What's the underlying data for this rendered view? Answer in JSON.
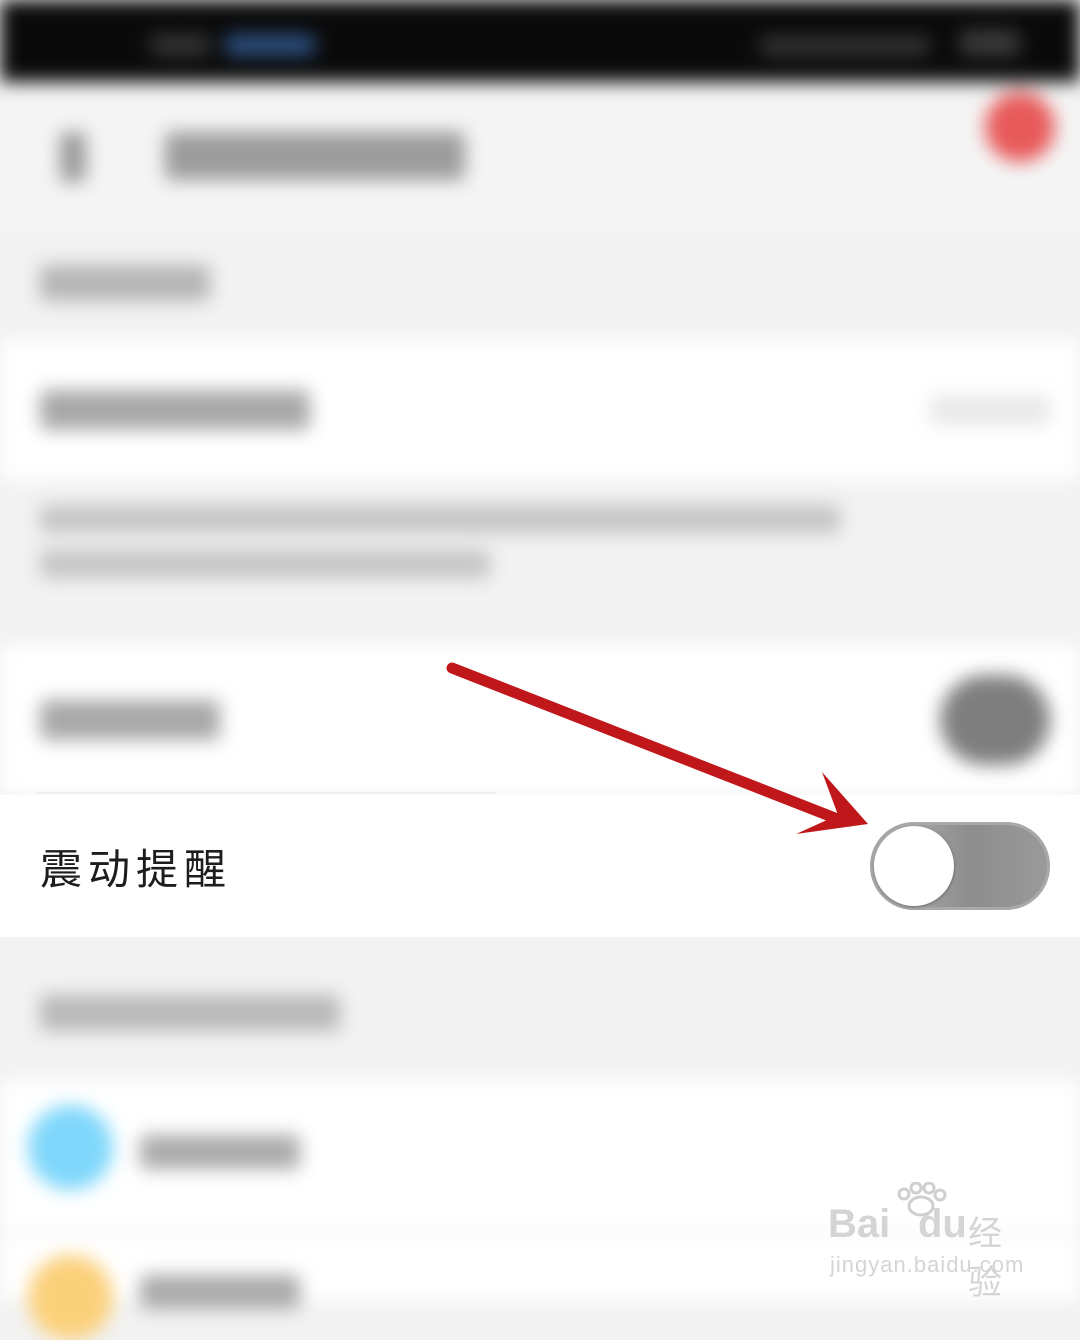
{
  "vibration_row": {
    "label": "震动提醒",
    "toggle_on": false
  },
  "watermark": {
    "brand_left": "Bai",
    "brand_right": "du",
    "brand_cn": "经验",
    "url": "jingyan.baidu.com"
  },
  "annotation": {
    "arrow_color": "#c0171b"
  },
  "colors": {
    "accent_red": "#e85a5a",
    "app_icon_blue": "#7fd7fb",
    "app_icon_yellow": "#fbd07a"
  }
}
